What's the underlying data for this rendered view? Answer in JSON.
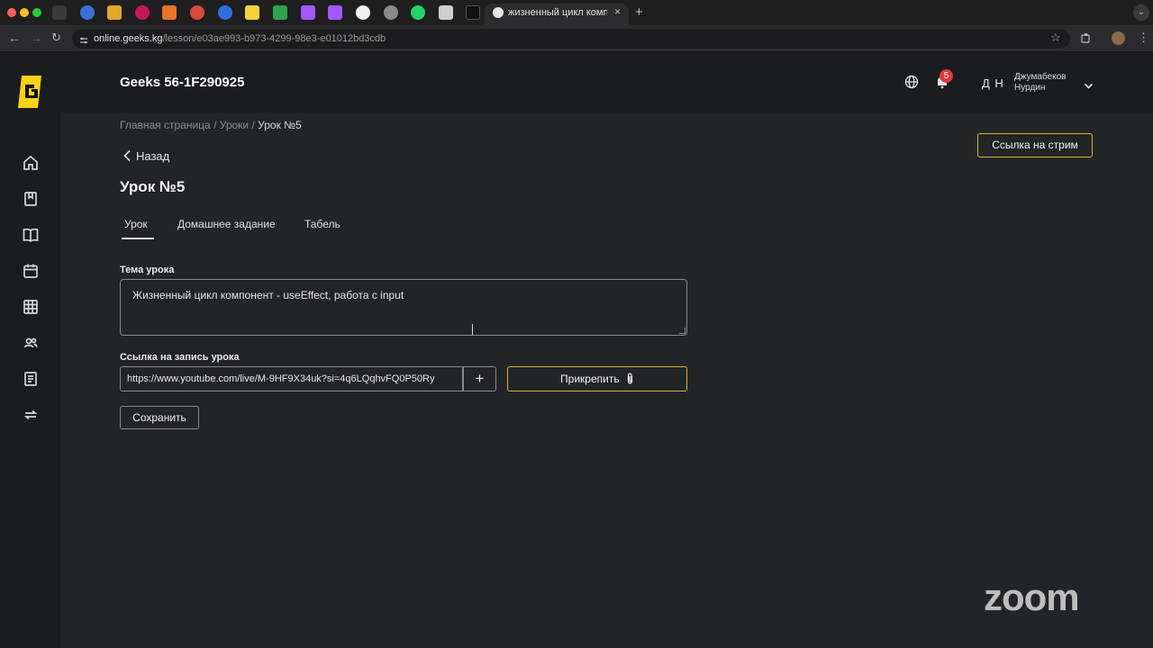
{
  "browser": {
    "active_tab_title": "жизненный цикл компонент",
    "tab_close": "×",
    "new_tab": "+",
    "url_host": "online.geeks.kg",
    "url_path": "/lesson/e03ae993-b973-4299-98e3-e01012bd3cdb"
  },
  "header": {
    "group_title": "Geeks 56-1F290925",
    "notification_count": "5",
    "user_initials": "Д Н",
    "user_last_name": "Джумабеков",
    "user_first_name": "Нурдин"
  },
  "breadcrumb": {
    "home": "Главная страница",
    "lessons": "Уроки",
    "current": "Урок №5",
    "sep": " / "
  },
  "main": {
    "back_label": "Назад",
    "page_title": "Урок №5",
    "stream_button": "Ссылка на стрим",
    "tabs": [
      {
        "label": "Урок"
      },
      {
        "label": "Домашнее задание"
      },
      {
        "label": "Табель"
      }
    ],
    "topic_label": "Тема урока",
    "topic_value": "Жизненный цикл компонент - useEffect, работа с input",
    "record_label": "Ссылка на запись урока",
    "record_value": "https://www.youtube.com/live/M-9HF9X34uk?si=4q6LQqhvFQ0P50Ry",
    "plus_label": "+",
    "attach_label": "Прикрепить",
    "save_label": "Сохранить"
  },
  "overlay": {
    "zoom_watermark": "zoom"
  },
  "colors": {
    "accent": "#d4b632",
    "background": "#232427",
    "sidebar": "#1b1c1f",
    "badge": "#e03b3b"
  }
}
